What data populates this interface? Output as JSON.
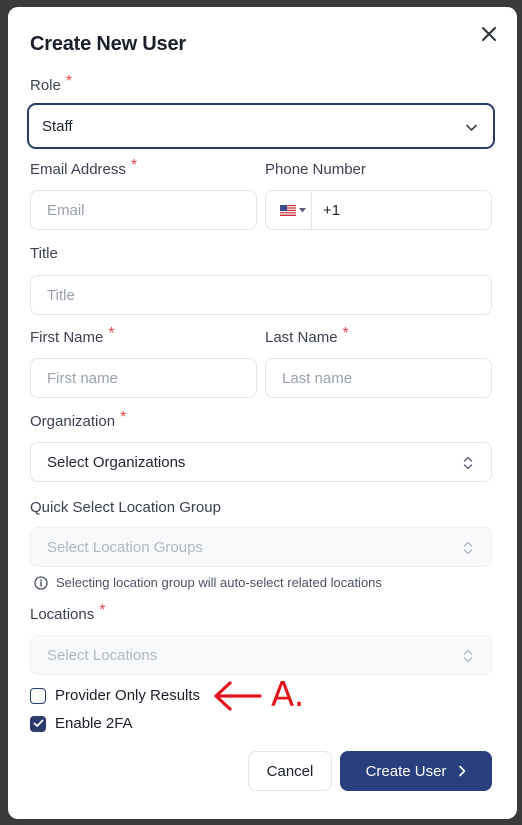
{
  "dialog": {
    "title": "Create New User"
  },
  "role": {
    "label": "Role",
    "value": "Staff"
  },
  "email": {
    "label": "Email Address",
    "placeholder": "Email"
  },
  "phone": {
    "label": "Phone Number",
    "country_code": "+1",
    "flag_icon": "us-flag-icon"
  },
  "title_field": {
    "label": "Title",
    "placeholder": "Title"
  },
  "first_name": {
    "label": "First Name",
    "placeholder": "First name"
  },
  "last_name": {
    "label": "Last Name",
    "placeholder": "Last name"
  },
  "organization": {
    "label": "Organization",
    "placeholder": "Select Organizations"
  },
  "location_group": {
    "label": "Quick Select Location Group",
    "placeholder": "Select Location Groups",
    "hint": "Selecting location group will auto-select related locations"
  },
  "locations": {
    "label": "Locations",
    "placeholder": "Select Locations"
  },
  "required_mark": "*",
  "checkboxes": {
    "provider_only": {
      "label": "Provider Only Results",
      "checked": false
    },
    "enable_2fa": {
      "label": "Enable 2FA",
      "checked": true
    }
  },
  "buttons": {
    "cancel": "Cancel",
    "create": "Create User"
  },
  "annotation": {
    "text": "A."
  },
  "colors": {
    "primary": "#2a3f7e",
    "required": "#e5484d",
    "annotation": "#e0141c",
    "backdrop": "#3a3a3a"
  }
}
